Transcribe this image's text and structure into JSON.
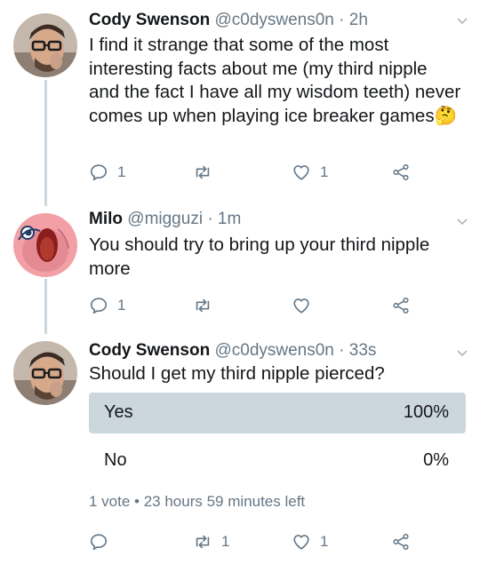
{
  "tweets": [
    {
      "name": "Cody Swenson",
      "handle": "@c0dyswens0n",
      "time": "· 2h",
      "text": "I find it strange that some of the most interesting facts about me (my third nipple and the fact I have all my wisdom teeth) never comes up when playing ice breaker games",
      "emoji": "🤔",
      "reply_count": "1",
      "retweet_count": "",
      "like_count": "1"
    },
    {
      "name": "Milo",
      "handle": "@migguzi",
      "time": "· 1m",
      "text": "You should try to bring up your third nipple more",
      "reply_count": "1",
      "retweet_count": "",
      "like_count": ""
    },
    {
      "name": "Cody Swenson",
      "handle": "@c0dyswens0n",
      "time": "· 33s",
      "text": "Should I get my third nipple pierced?",
      "reply_count": "",
      "retweet_count": "1",
      "like_count": "1",
      "poll": {
        "options": [
          {
            "label": "Yes",
            "percent": "100%",
            "share": 1.0
          },
          {
            "label": "No",
            "percent": "0%",
            "share": 0.0
          }
        ],
        "meta": "1 vote • 23 hours 59 minutes left"
      }
    }
  ],
  "icons": {
    "reply": "reply-icon",
    "retweet": "retweet-icon",
    "like": "heart-icon",
    "share": "share-icon",
    "menu": "chevron-down-icon"
  },
  "colors": {
    "text": "#14171a",
    "secondary": "#657786",
    "thread_line": "#ccd6dd",
    "poll_winner": "#ccd6dd"
  }
}
